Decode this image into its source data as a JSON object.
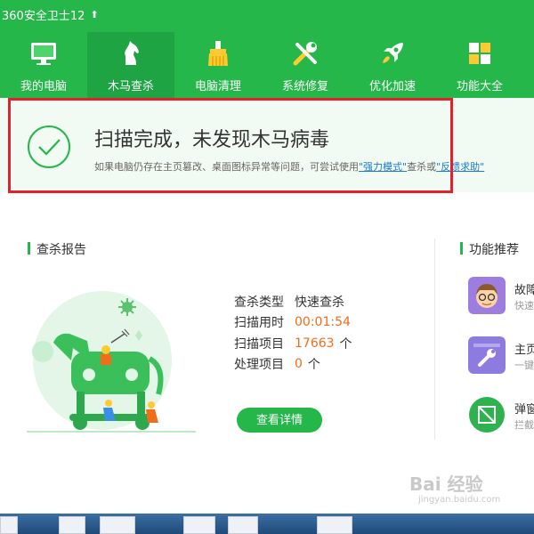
{
  "window": {
    "title": "360安全卫士12"
  },
  "nav": {
    "items": [
      {
        "label": "我的电脑"
      },
      {
        "label": "木马查杀"
      },
      {
        "label": "电脑清理"
      },
      {
        "label": "系统修复"
      },
      {
        "label": "优化加速"
      },
      {
        "label": "功能大全"
      }
    ],
    "active": "木马查杀"
  },
  "banner": {
    "title": "扫描完成，未发现木马病毒",
    "desc_prefix": "如果电脑仍存在主页篡改、桌面图标异常等问题，可尝试使用",
    "link1": "\"强力模式\"",
    "desc_mid": "查杀或",
    "link2": "\"反馈求助\""
  },
  "report": {
    "title": "查杀报告",
    "rows": [
      {
        "label": "查杀类型",
        "value": "快速查杀",
        "unit": ""
      },
      {
        "label": "扫描用时",
        "value": "00:01:54",
        "unit": ""
      },
      {
        "label": "扫描项目",
        "value": "17663",
        "unit": "个"
      },
      {
        "label": "处理项目",
        "value": "0",
        "unit": "个"
      }
    ],
    "detail_button": "查看详情"
  },
  "recommend": {
    "title": "功能推荐",
    "items": [
      {
        "title": "故障",
        "sub": "快速"
      },
      {
        "title": "主页",
        "sub": "一键"
      },
      {
        "title": "弹窗",
        "sub": "拦截"
      }
    ]
  },
  "watermark": {
    "text": "Bai 经验",
    "sub": "jingyan.baidu.com"
  },
  "colors": {
    "brand_green": "#25b74a",
    "highlight_red": "#e4202b",
    "value_orange": "#f26c1b",
    "link_blue": "#1a7bd0"
  }
}
